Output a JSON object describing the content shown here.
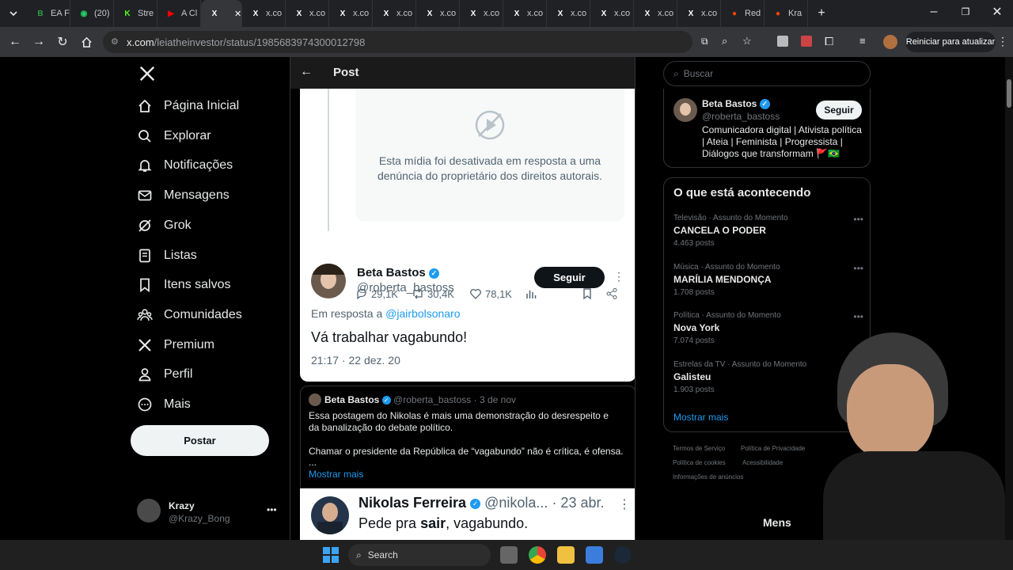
{
  "browser": {
    "tabs": [
      {
        "label": "EA F",
        "icon": "bet-icon",
        "color": "#2f9e44"
      },
      {
        "label": "(20)",
        "icon": "whatsapp-icon",
        "color": "#25d366"
      },
      {
        "label": "Stre",
        "icon": "kick-icon",
        "color": "#53fc18"
      },
      {
        "label": "A Cl",
        "icon": "youtube-icon",
        "color": "#ff0000"
      },
      {
        "label": "",
        "icon": "x-icon",
        "color": "#ffffff"
      },
      {
        "label": "x.co",
        "icon": "x-icon",
        "color": "#ffffff"
      },
      {
        "label": "x.co",
        "icon": "x-icon",
        "color": "#ffffff"
      },
      {
        "label": "x.co",
        "icon": "x-icon",
        "color": "#ffffff"
      },
      {
        "label": "x.co",
        "icon": "x-icon",
        "color": "#ffffff"
      },
      {
        "label": "x.co",
        "icon": "x-icon",
        "color": "#ffffff"
      },
      {
        "label": "x.co",
        "icon": "x-icon",
        "color": "#ffffff"
      },
      {
        "label": "x.co",
        "icon": "x-icon",
        "color": "#ffffff"
      },
      {
        "label": "x.co",
        "icon": "x-icon",
        "color": "#ffffff"
      },
      {
        "label": "x.co",
        "icon": "x-icon",
        "color": "#ffffff"
      },
      {
        "label": "x.co",
        "icon": "x-icon",
        "color": "#ffffff"
      },
      {
        "label": "x.co",
        "icon": "x-icon",
        "color": "#ffffff"
      },
      {
        "label": "Red",
        "icon": "reddit-icon",
        "color": "#ff4500"
      },
      {
        "label": "Kra",
        "icon": "reddit-icon",
        "color": "#ff4500"
      }
    ],
    "url_domain": "x.com",
    "url_path": "/leiatheinvestor/status/1985683974300012798",
    "restart_label": "Reiniciar para atualizar"
  },
  "sidebar": {
    "items": [
      {
        "label": "Página Inicial",
        "icon": "home-icon"
      },
      {
        "label": "Explorar",
        "icon": "search-icon"
      },
      {
        "label": "Notificações",
        "icon": "bell-icon"
      },
      {
        "label": "Mensagens",
        "icon": "mail-icon"
      },
      {
        "label": "Grok",
        "icon": "grok-icon"
      },
      {
        "label": "Listas",
        "icon": "list-icon"
      },
      {
        "label": "Itens salvos",
        "icon": "bookmark-icon"
      },
      {
        "label": "Comunidades",
        "icon": "people-icon"
      },
      {
        "label": "Premium",
        "icon": "x-icon"
      },
      {
        "label": "Perfil",
        "icon": "person-icon"
      },
      {
        "label": "Mais",
        "icon": "more-circle-icon"
      }
    ],
    "post_label": "Postar",
    "account": {
      "name": "Krazy",
      "handle": "@Krazy_Bong"
    }
  },
  "main": {
    "header_title": "Post",
    "media_disabled_text": "Esta mídia foi desativada em resposta a uma denúncia do proprietário dos direitos autorais.",
    "stats": {
      "replies": "29,1K",
      "reposts": "30,4K",
      "likes": "78,1K"
    },
    "tweet": {
      "name": "Beta Bastos",
      "handle": "@roberta_bastoss",
      "follow_label": "Seguir",
      "reply_prefix": "Em resposta a",
      "reply_to": "@jairbolsonaro",
      "text": "Vá trabalhar vagabundo!",
      "timestamp": "21:17 · 22 dez. 20"
    },
    "quote": {
      "name": "Beta Bastos",
      "handle": "@roberta_bastoss",
      "date": "· 3 de nov",
      "text1": "Essa postagem do Nikolas é mais uma demonstração do desrespeito e da banalização do debate político.",
      "text2": "Chamar o presidente da República de “vagabundo” não é crítica, é ofensa.",
      "ellipsis": "...",
      "show_more": "Mostrar mais"
    },
    "nikolas": {
      "name": "Nikolas Ferreira",
      "handle": "@nikola...",
      "date": "· 23 abr.",
      "text_before": "Pede pra ",
      "text_bold": "sair",
      "text_after": ", vagabundo."
    }
  },
  "right": {
    "search_placeholder": "Buscar",
    "profile": {
      "name": "Beta Bastos",
      "handle": "@roberta_bastoss",
      "follow_label": "Seguir",
      "bio": "Comunicadora digital | Ativista política | Ateia | Feminista | Progressista | Diálogos que transformam 🚩🇧🇷"
    },
    "trends_title": "O que está acontecendo",
    "trends": [
      {
        "category": "Televisão · Assunto do Momento",
        "name": "CANCELA O PODER",
        "count": "4.463 posts"
      },
      {
        "category": "Música · Assunto do Momento",
        "name": "MARÍLIA MENDONÇA",
        "count": "1.708 posts"
      },
      {
        "category": "Política · Assunto do Momento",
        "name": "Nova York",
        "count": "7.074 posts"
      },
      {
        "category": "Estrelas da TV · Assunto do Momento",
        "name": "Galisteu",
        "count": "1.903 posts"
      }
    ],
    "show_more": "Mostrar mais",
    "footer": [
      "Termos de Serviço",
      "Política de Privacidade",
      "Política de cookies",
      "Acessibilidade",
      "Informações de anúncios"
    ],
    "messages_label": "Mens"
  },
  "taskbar": {
    "search_label": "Search"
  },
  "colors": {
    "accent": "#1d9bf0",
    "brand": "#000000",
    "follow_dark": "#0f1419"
  }
}
